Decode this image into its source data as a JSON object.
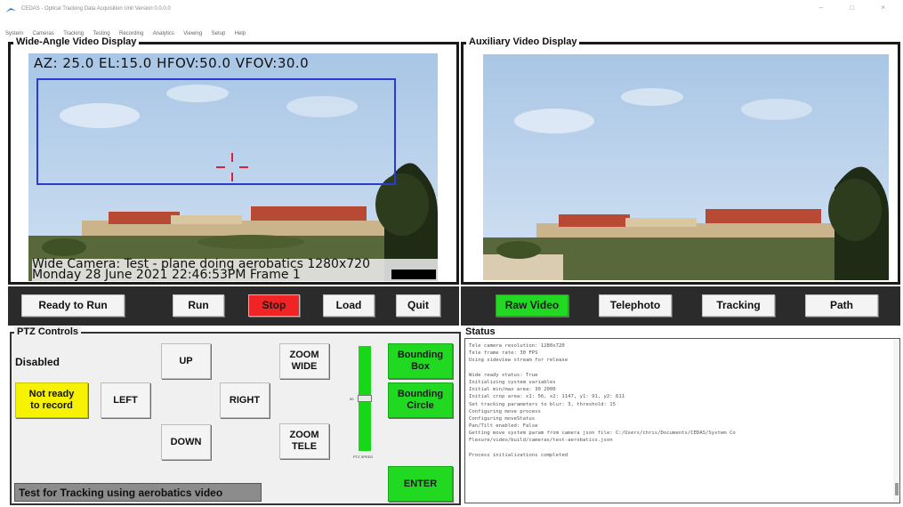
{
  "window": {
    "title": "CEDAS - Optical Tracking Data Acquisition Unit  Version 0.0.0.0",
    "controls": "–  □  ×"
  },
  "menu": [
    "System",
    "Cameras",
    "Tracking",
    "Testing",
    "Recording",
    "Analytics",
    "Viewing",
    "Setup",
    "Help"
  ],
  "wide": {
    "title": "Wide-Angle Video Display",
    "osd_top": "AZ: 25.0  EL:15.0   HFOV:50.0  VFOV:30.0",
    "osd_line1": "Wide Camera: Test - plane doing aerobatics  1280x720",
    "osd_line2": "Monday 28 June 2021 22:46:53PM      Frame 1",
    "box_color": "#2a3bd4",
    "crosshair_color": "#e0203a"
  },
  "aux": {
    "title": "Auxiliary Video Display"
  },
  "left_buttons": {
    "ready": "Ready to Run",
    "run": "Run",
    "stop": "Stop",
    "load": "Load",
    "quit": "Quit"
  },
  "right_buttons": {
    "raw": "Raw Video",
    "telephoto": "Telephoto",
    "tracking": "Tracking",
    "path": "Path"
  },
  "ptz": {
    "title": "PTZ Controls",
    "mode": "Disabled",
    "record": "Not ready to record",
    "up": "UP",
    "down": "DOWN",
    "left": "LEFT",
    "right": "RIGHT",
    "zoom_wide": "ZOOM WIDE",
    "zoom_tele": "ZOOM TELE",
    "bbox": "Bounding Box",
    "bcircle": "Bounding Circle",
    "enter": "ENTER",
    "speed_label": "PTZ SPEED",
    "speed_value": "50",
    "speed_level": 0.5,
    "caption": "Test for Tracking using aerobatics video"
  },
  "status": {
    "title": "Status",
    "lines": [
      "Tele camera resolution: 1280x720",
      "Tele frame rate: 30 FPS",
      "Using sideview stream for release",
      "",
      "Wide ready status: True",
      "Initializing system variables",
      "Initial min/max area: 30  2000",
      "Initial crop area: x1: 56, x2: 1147, y1: 91, y2: 611",
      "Set tracking parameters to blur: 3, threshold: 15",
      "Configuring move process",
      "Configuring moveStatus",
      "Pan/Tilt enabled: False",
      "Getting move system param from camera json file: C:/Users/chris/Documents/CEDAS/System Co",
      "Flexure/video/build/cameras/test-aerobatics.json",
      "",
      "Process initializations completed"
    ]
  },
  "colors": {
    "stop_red": "#f02424",
    "green": "#22d922",
    "yellow": "#f7f200",
    "bar_dark": "#2b2b2b"
  }
}
